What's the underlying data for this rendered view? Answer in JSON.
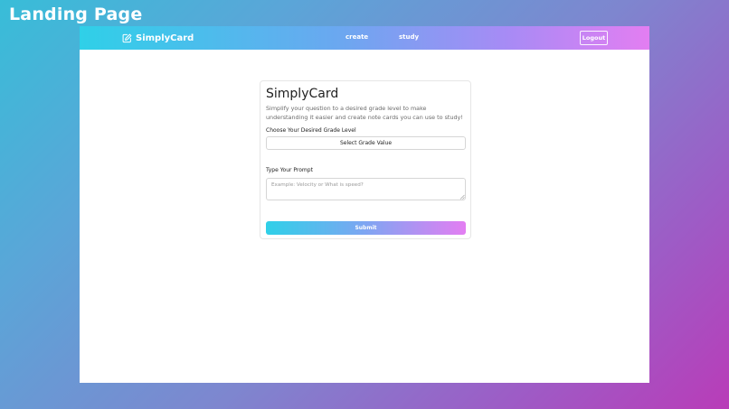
{
  "page": {
    "heading": "Landing Page"
  },
  "navbar": {
    "brand": {
      "name": "SimplyCard",
      "icon": "edit-icon"
    },
    "links": [
      {
        "label": "create"
      },
      {
        "label": "study"
      }
    ],
    "logout_label": "Logout"
  },
  "form": {
    "title": "SimplyCard",
    "description": "Simplify your question to a desired grade level to make understanding it easier and create note cards you can use to study!",
    "grade_label": "Choose Your Desired Grade Level",
    "grade_select_value": "Select Grade Value",
    "prompt_label": "Type Your Prompt",
    "prompt_placeholder": "Example: Velocity or What is speed?",
    "prompt_value": "",
    "submit_label": "Submit"
  },
  "colors": {
    "navbar_gradient": [
      "#2fd0e8",
      "#a78bf5",
      "#e37ef2"
    ],
    "background_gradient": [
      "#38bdd8",
      "#b93cb8"
    ]
  }
}
